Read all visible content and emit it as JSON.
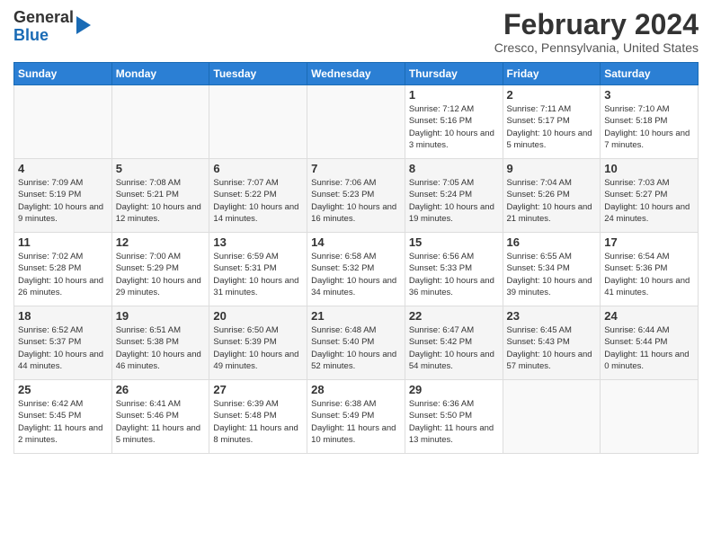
{
  "logo": {
    "general": "General",
    "blue": "Blue"
  },
  "header": {
    "month": "February 2024",
    "location": "Cresco, Pennsylvania, United States"
  },
  "weekdays": [
    "Sunday",
    "Monday",
    "Tuesday",
    "Wednesday",
    "Thursday",
    "Friday",
    "Saturday"
  ],
  "weeks": [
    [
      {
        "day": "",
        "info": ""
      },
      {
        "day": "",
        "info": ""
      },
      {
        "day": "",
        "info": ""
      },
      {
        "day": "",
        "info": ""
      },
      {
        "day": "1",
        "info": "Sunrise: 7:12 AM\nSunset: 5:16 PM\nDaylight: 10 hours\nand 3 minutes."
      },
      {
        "day": "2",
        "info": "Sunrise: 7:11 AM\nSunset: 5:17 PM\nDaylight: 10 hours\nand 5 minutes."
      },
      {
        "day": "3",
        "info": "Sunrise: 7:10 AM\nSunset: 5:18 PM\nDaylight: 10 hours\nand 7 minutes."
      }
    ],
    [
      {
        "day": "4",
        "info": "Sunrise: 7:09 AM\nSunset: 5:19 PM\nDaylight: 10 hours\nand 9 minutes."
      },
      {
        "day": "5",
        "info": "Sunrise: 7:08 AM\nSunset: 5:21 PM\nDaylight: 10 hours\nand 12 minutes."
      },
      {
        "day": "6",
        "info": "Sunrise: 7:07 AM\nSunset: 5:22 PM\nDaylight: 10 hours\nand 14 minutes."
      },
      {
        "day": "7",
        "info": "Sunrise: 7:06 AM\nSunset: 5:23 PM\nDaylight: 10 hours\nand 16 minutes."
      },
      {
        "day": "8",
        "info": "Sunrise: 7:05 AM\nSunset: 5:24 PM\nDaylight: 10 hours\nand 19 minutes."
      },
      {
        "day": "9",
        "info": "Sunrise: 7:04 AM\nSunset: 5:26 PM\nDaylight: 10 hours\nand 21 minutes."
      },
      {
        "day": "10",
        "info": "Sunrise: 7:03 AM\nSunset: 5:27 PM\nDaylight: 10 hours\nand 24 minutes."
      }
    ],
    [
      {
        "day": "11",
        "info": "Sunrise: 7:02 AM\nSunset: 5:28 PM\nDaylight: 10 hours\nand 26 minutes."
      },
      {
        "day": "12",
        "info": "Sunrise: 7:00 AM\nSunset: 5:29 PM\nDaylight: 10 hours\nand 29 minutes."
      },
      {
        "day": "13",
        "info": "Sunrise: 6:59 AM\nSunset: 5:31 PM\nDaylight: 10 hours\nand 31 minutes."
      },
      {
        "day": "14",
        "info": "Sunrise: 6:58 AM\nSunset: 5:32 PM\nDaylight: 10 hours\nand 34 minutes."
      },
      {
        "day": "15",
        "info": "Sunrise: 6:56 AM\nSunset: 5:33 PM\nDaylight: 10 hours\nand 36 minutes."
      },
      {
        "day": "16",
        "info": "Sunrise: 6:55 AM\nSunset: 5:34 PM\nDaylight: 10 hours\nand 39 minutes."
      },
      {
        "day": "17",
        "info": "Sunrise: 6:54 AM\nSunset: 5:36 PM\nDaylight: 10 hours\nand 41 minutes."
      }
    ],
    [
      {
        "day": "18",
        "info": "Sunrise: 6:52 AM\nSunset: 5:37 PM\nDaylight: 10 hours\nand 44 minutes."
      },
      {
        "day": "19",
        "info": "Sunrise: 6:51 AM\nSunset: 5:38 PM\nDaylight: 10 hours\nand 46 minutes."
      },
      {
        "day": "20",
        "info": "Sunrise: 6:50 AM\nSunset: 5:39 PM\nDaylight: 10 hours\nand 49 minutes."
      },
      {
        "day": "21",
        "info": "Sunrise: 6:48 AM\nSunset: 5:40 PM\nDaylight: 10 hours\nand 52 minutes."
      },
      {
        "day": "22",
        "info": "Sunrise: 6:47 AM\nSunset: 5:42 PM\nDaylight: 10 hours\nand 54 minutes."
      },
      {
        "day": "23",
        "info": "Sunrise: 6:45 AM\nSunset: 5:43 PM\nDaylight: 10 hours\nand 57 minutes."
      },
      {
        "day": "24",
        "info": "Sunrise: 6:44 AM\nSunset: 5:44 PM\nDaylight: 11 hours\nand 0 minutes."
      }
    ],
    [
      {
        "day": "25",
        "info": "Sunrise: 6:42 AM\nSunset: 5:45 PM\nDaylight: 11 hours\nand 2 minutes."
      },
      {
        "day": "26",
        "info": "Sunrise: 6:41 AM\nSunset: 5:46 PM\nDaylight: 11 hours\nand 5 minutes."
      },
      {
        "day": "27",
        "info": "Sunrise: 6:39 AM\nSunset: 5:48 PM\nDaylight: 11 hours\nand 8 minutes."
      },
      {
        "day": "28",
        "info": "Sunrise: 6:38 AM\nSunset: 5:49 PM\nDaylight: 11 hours\nand 10 minutes."
      },
      {
        "day": "29",
        "info": "Sunrise: 6:36 AM\nSunset: 5:50 PM\nDaylight: 11 hours\nand 13 minutes."
      },
      {
        "day": "",
        "info": ""
      },
      {
        "day": "",
        "info": ""
      }
    ]
  ]
}
